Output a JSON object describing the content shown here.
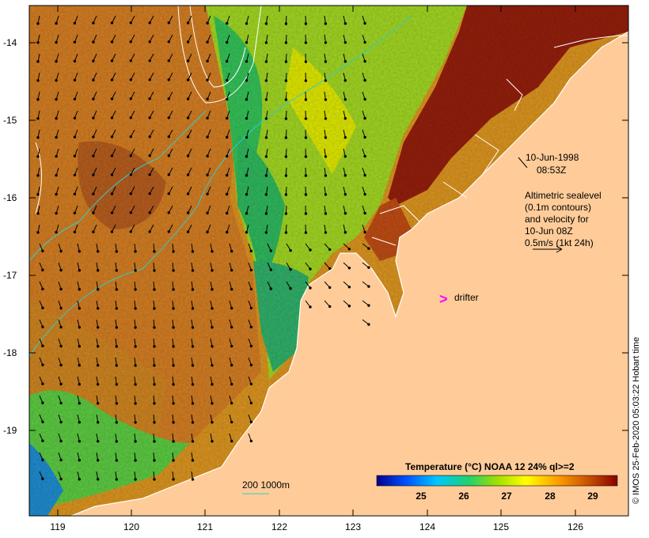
{
  "map": {
    "lat_ticks": [
      "-14",
      "-15",
      "-16",
      "-17",
      "-18",
      "-19"
    ],
    "lon_ticks": [
      "119",
      "120",
      "121",
      "122",
      "123",
      "124",
      "125",
      "126"
    ],
    "date_label": "10-Jun-1998",
    "time_label": "08:53Z",
    "altimetry_lines": [
      "Altimetric sealevel",
      "(0.1m contours)",
      "and velocity for",
      "10-Jun 08Z",
      "0.5m/s (1kt 24h)"
    ],
    "drifter_label": "drifter",
    "drifter_symbol": ">",
    "isobath_label": "200  1000m",
    "colorbar": {
      "title": "Temperature (°C) NOAA 12 24% ql>=2",
      "ticks": [
        "25",
        "26",
        "27",
        "28",
        "29"
      ],
      "colors": [
        "#00008b",
        "#0050ff",
        "#00c8ff",
        "#20d070",
        "#a0e000",
        "#ffff00",
        "#ffa000",
        "#c85000",
        "#8b0000"
      ]
    },
    "credit": "© IMOS 25-Feb-2020 05:03:22 Hobart time",
    "colors": {
      "land": "#ffcc99",
      "drifter": "#ff00ff",
      "isobath": "#33cccc",
      "coast": "#ffffff"
    }
  }
}
